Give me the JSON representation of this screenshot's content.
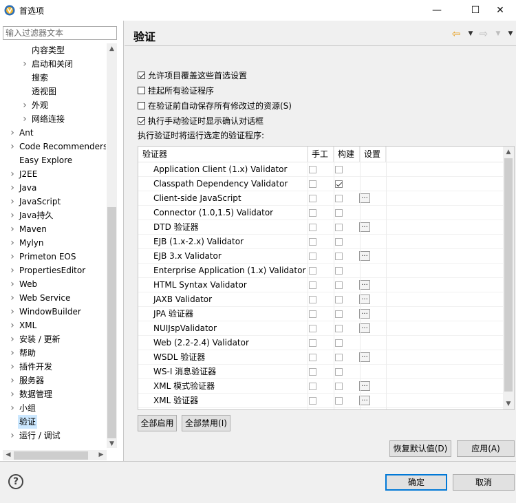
{
  "window": {
    "title": "首选项",
    "minimize": "—",
    "maximize": "☐",
    "close": "✕"
  },
  "filter": {
    "placeholder": "输入过滤器文本"
  },
  "tree": [
    {
      "label": "内容类型",
      "level": 1,
      "chevron": false
    },
    {
      "label": "启动和关闭",
      "level": 1,
      "chevron": true
    },
    {
      "label": "搜索",
      "level": 1,
      "chevron": false
    },
    {
      "label": "透视图",
      "level": 1,
      "chevron": false
    },
    {
      "label": "外观",
      "level": 1,
      "chevron": true
    },
    {
      "label": "网络连接",
      "level": 1,
      "chevron": true
    },
    {
      "label": "Ant",
      "level": 0,
      "chevron": true
    },
    {
      "label": "Code Recommenders",
      "level": 0,
      "chevron": true
    },
    {
      "label": "Easy Explore",
      "level": 0,
      "chevron": false
    },
    {
      "label": "J2EE",
      "level": 0,
      "chevron": true
    },
    {
      "label": "Java",
      "level": 0,
      "chevron": true
    },
    {
      "label": "JavaScript",
      "level": 0,
      "chevron": true
    },
    {
      "label": "Java持久",
      "level": 0,
      "chevron": true
    },
    {
      "label": "Maven",
      "level": 0,
      "chevron": true
    },
    {
      "label": "Mylyn",
      "level": 0,
      "chevron": true
    },
    {
      "label": "Primeton EOS",
      "level": 0,
      "chevron": true
    },
    {
      "label": "PropertiesEditor",
      "level": 0,
      "chevron": true
    },
    {
      "label": "Web",
      "level": 0,
      "chevron": true
    },
    {
      "label": "Web Service",
      "level": 0,
      "chevron": true
    },
    {
      "label": "WindowBuilder",
      "level": 0,
      "chevron": true
    },
    {
      "label": "XML",
      "level": 0,
      "chevron": true
    },
    {
      "label": "安装 / 更新",
      "level": 0,
      "chevron": true
    },
    {
      "label": "帮助",
      "level": 0,
      "chevron": true
    },
    {
      "label": "插件开发",
      "level": 0,
      "chevron": true
    },
    {
      "label": "服务器",
      "level": 0,
      "chevron": true
    },
    {
      "label": "数据管理",
      "level": 0,
      "chevron": true
    },
    {
      "label": "小组",
      "level": 0,
      "chevron": true
    },
    {
      "label": "验证",
      "level": 0,
      "chevron": false,
      "selected": true
    },
    {
      "label": "运行 / 调试",
      "level": 0,
      "chevron": true
    }
  ],
  "page": {
    "title": "验证"
  },
  "options": [
    {
      "label": "允许项目覆盖这些首选设置",
      "checked": true
    },
    {
      "label": "挂起所有验证程序",
      "checked": false
    },
    {
      "label": "在验证前自动保存所有修改过的资源(S)",
      "checked": false
    },
    {
      "label": "执行手动验证时显示确认对话框",
      "checked": true
    }
  ],
  "list_label": "执行验证时将运行选定的验证程序:",
  "table": {
    "headers": {
      "validator": "验证器",
      "manual": "手工",
      "build": "构建",
      "settings": "设置"
    },
    "rows": [
      {
        "name": "Application Client (1.x) Validator",
        "manual": false,
        "build": false,
        "settings": false
      },
      {
        "name": "Classpath Dependency Validator",
        "manual": false,
        "build": true,
        "settings": false
      },
      {
        "name": "Client-side JavaScript",
        "manual": false,
        "build": false,
        "settings": true
      },
      {
        "name": "Connector (1.0,1.5) Validator",
        "manual": false,
        "build": false,
        "settings": false
      },
      {
        "name": "DTD 验证器",
        "manual": false,
        "build": false,
        "settings": true
      },
      {
        "name": "EJB (1.x-2.x) Validator",
        "manual": false,
        "build": false,
        "settings": false
      },
      {
        "name": "EJB 3.x Validator",
        "manual": false,
        "build": false,
        "settings": true
      },
      {
        "name": "Enterprise Application (1.x) Validator",
        "manual": false,
        "build": false,
        "settings": false
      },
      {
        "name": "HTML Syntax Validator",
        "manual": false,
        "build": false,
        "settings": true
      },
      {
        "name": "JAXB Validator",
        "manual": false,
        "build": false,
        "settings": true
      },
      {
        "name": "JPA 验证器",
        "manual": false,
        "build": false,
        "settings": true
      },
      {
        "name": "NUIJspValidator",
        "manual": false,
        "build": false,
        "settings": true
      },
      {
        "name": "Web (2.2-2.4) Validator",
        "manual": false,
        "build": false,
        "settings": false
      },
      {
        "name": "WSDL 验证器",
        "manual": false,
        "build": false,
        "settings": true
      },
      {
        "name": "WS-I 消息验证器",
        "manual": false,
        "build": false,
        "settings": false
      },
      {
        "name": "XML 模式验证器",
        "manual": false,
        "build": false,
        "settings": true
      },
      {
        "name": "XML 验证器",
        "manual": false,
        "build": false,
        "settings": true
      }
    ],
    "settings_button": "..."
  },
  "buttons": {
    "enable_all": "全部启用",
    "disable_all": "全部禁用(I)",
    "restore_defaults": "恢复默认值(D)",
    "apply": "应用(A)",
    "ok": "确定",
    "cancel": "取消",
    "help": "?"
  },
  "colors": {
    "accent": "#0078d7",
    "selection": "#cce8ff",
    "back_arrow": "#e8a020"
  }
}
